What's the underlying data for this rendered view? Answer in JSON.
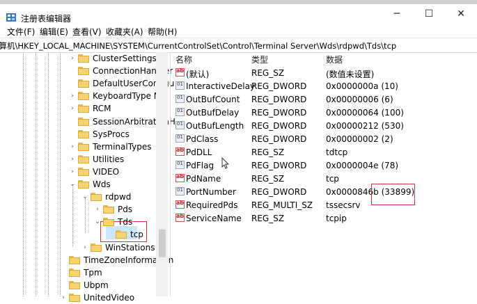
{
  "window": {
    "title": "注册表编辑器",
    "minimize": "─",
    "maximize": "☐",
    "close": "✕"
  },
  "menu": [
    {
      "label": "文件(F)"
    },
    {
      "label": "编辑(E)"
    },
    {
      "label": "查看(V)"
    },
    {
      "label": "收藏夹(A)"
    },
    {
      "label": "帮助(H)"
    }
  ],
  "address": "计算机\\HKEY_LOCAL_MACHINE\\SYSTEM\\CurrentControlSet\\Control\\Terminal Server\\Wds\\rdpwd\\Tds\\tcp",
  "tree": [
    {
      "label": "ClusterSettings",
      "chev": "›"
    },
    {
      "label": "ConnectionHandler",
      "chev": ""
    },
    {
      "label": "DefaultUserConfigu",
      "chev": ""
    },
    {
      "label": "KeyboardType Ma",
      "chev": "›"
    },
    {
      "label": "RCM",
      "chev": "›"
    },
    {
      "label": "SessionArbitrationH",
      "chev": ""
    },
    {
      "label": "SysProcs",
      "chev": ""
    },
    {
      "label": "TerminalTypes",
      "chev": "›"
    },
    {
      "label": "Utilities",
      "chev": "›"
    },
    {
      "label": "VIDEO",
      "chev": "›"
    },
    {
      "label": "Wds",
      "chev": "⌄"
    },
    {
      "label": "rdpwd",
      "chev": "⌄"
    },
    {
      "label": "Pds",
      "chev": "›"
    },
    {
      "label": "Tds",
      "chev": "⌄"
    },
    {
      "label": "tcp",
      "chev": ""
    },
    {
      "label": "WinStations",
      "chev": "›"
    },
    {
      "label": "TimeZoneInformation",
      "chev": ""
    },
    {
      "label": "Tpm",
      "chev": ""
    },
    {
      "label": "Ubpm",
      "chev": ""
    },
    {
      "label": "UnitedVideo",
      "chev": "›"
    }
  ],
  "columns": {
    "name": "名称",
    "type": "类型",
    "data": "数据"
  },
  "values": [
    {
      "name": "(默认)",
      "type": "REG_SZ",
      "data": "(数值未设置)",
      "icon": "ab"
    },
    {
      "name": "InteractiveDelay",
      "type": "REG_DWORD",
      "data": "0x0000000a (10)",
      "icon": "bin"
    },
    {
      "name": "OutBufCount",
      "type": "REG_DWORD",
      "data": "0x00000006 (6)",
      "icon": "bin"
    },
    {
      "name": "OutBufDelay",
      "type": "REG_DWORD",
      "data": "0x00000064 (100)",
      "icon": "bin"
    },
    {
      "name": "OutBufLength",
      "type": "REG_DWORD",
      "data": "0x00000212 (530)",
      "icon": "bin"
    },
    {
      "name": "PdClass",
      "type": "REG_DWORD",
      "data": "0x00000002 (2)",
      "icon": "bin"
    },
    {
      "name": "PdDLL",
      "type": "REG_SZ",
      "data": "tdtcp",
      "icon": "ab"
    },
    {
      "name": "PdFlag",
      "type": "REG_DWORD",
      "data": "0x0000004e (78)",
      "icon": "bin"
    },
    {
      "name": "PdName",
      "type": "REG_SZ",
      "data": "tcp",
      "icon": "ab"
    },
    {
      "name": "PortNumber",
      "type": "REG_DWORD",
      "data": "0x0000846b (33899)",
      "icon": "bin"
    },
    {
      "name": "RequiredPds",
      "type": "REG_MULTI_SZ",
      "data": "tssecsrv",
      "icon": "ab"
    },
    {
      "name": "ServiceName",
      "type": "REG_SZ",
      "data": "tcpip",
      "icon": "ab"
    }
  ]
}
